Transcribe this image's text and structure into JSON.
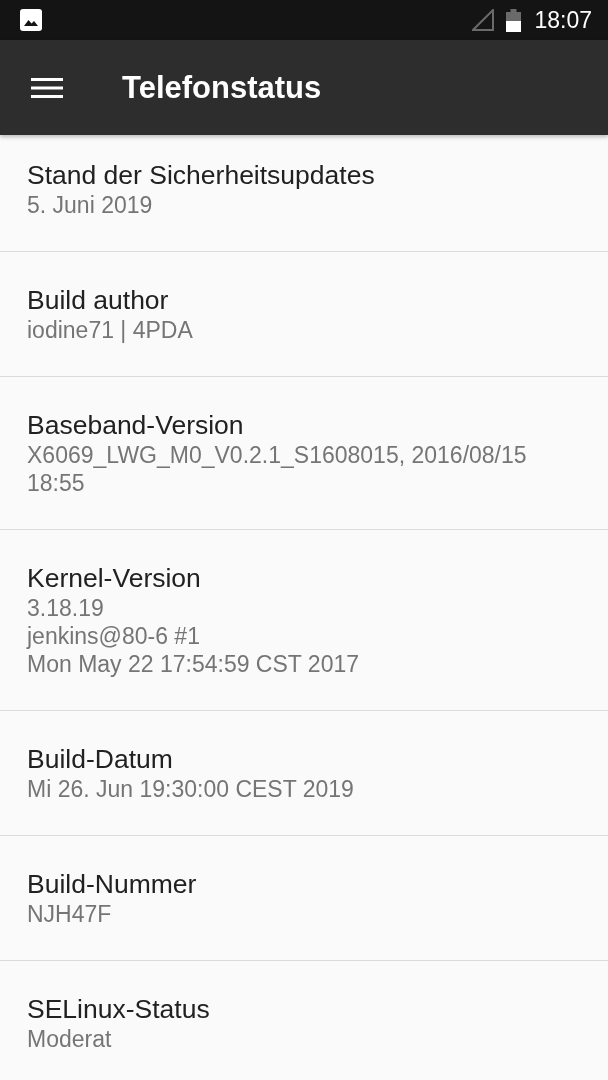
{
  "status_bar": {
    "time": "18:07"
  },
  "app_bar": {
    "title": "Telefonstatus"
  },
  "items": [
    {
      "title": "Stand der Sicherheitsupdates",
      "summary": "5. Juni 2019"
    },
    {
      "title": "Build author",
      "summary": "iodine71 | 4PDA"
    },
    {
      "title": "Baseband-Version",
      "summary": "X6069_LWG_M0_V0.2.1_S1608015, 2016/08/15 18:55"
    },
    {
      "title": "Kernel-Version",
      "summary": "3.18.19\njenkins@80-6 #1\nMon May 22 17:54:59 CST 2017"
    },
    {
      "title": "Build-Datum",
      "summary": "Mi 26. Jun 19:30:00 CEST 2019"
    },
    {
      "title": "Build-Nummer",
      "summary": "NJH47F"
    },
    {
      "title": "SELinux-Status",
      "summary": "Moderat"
    }
  ]
}
